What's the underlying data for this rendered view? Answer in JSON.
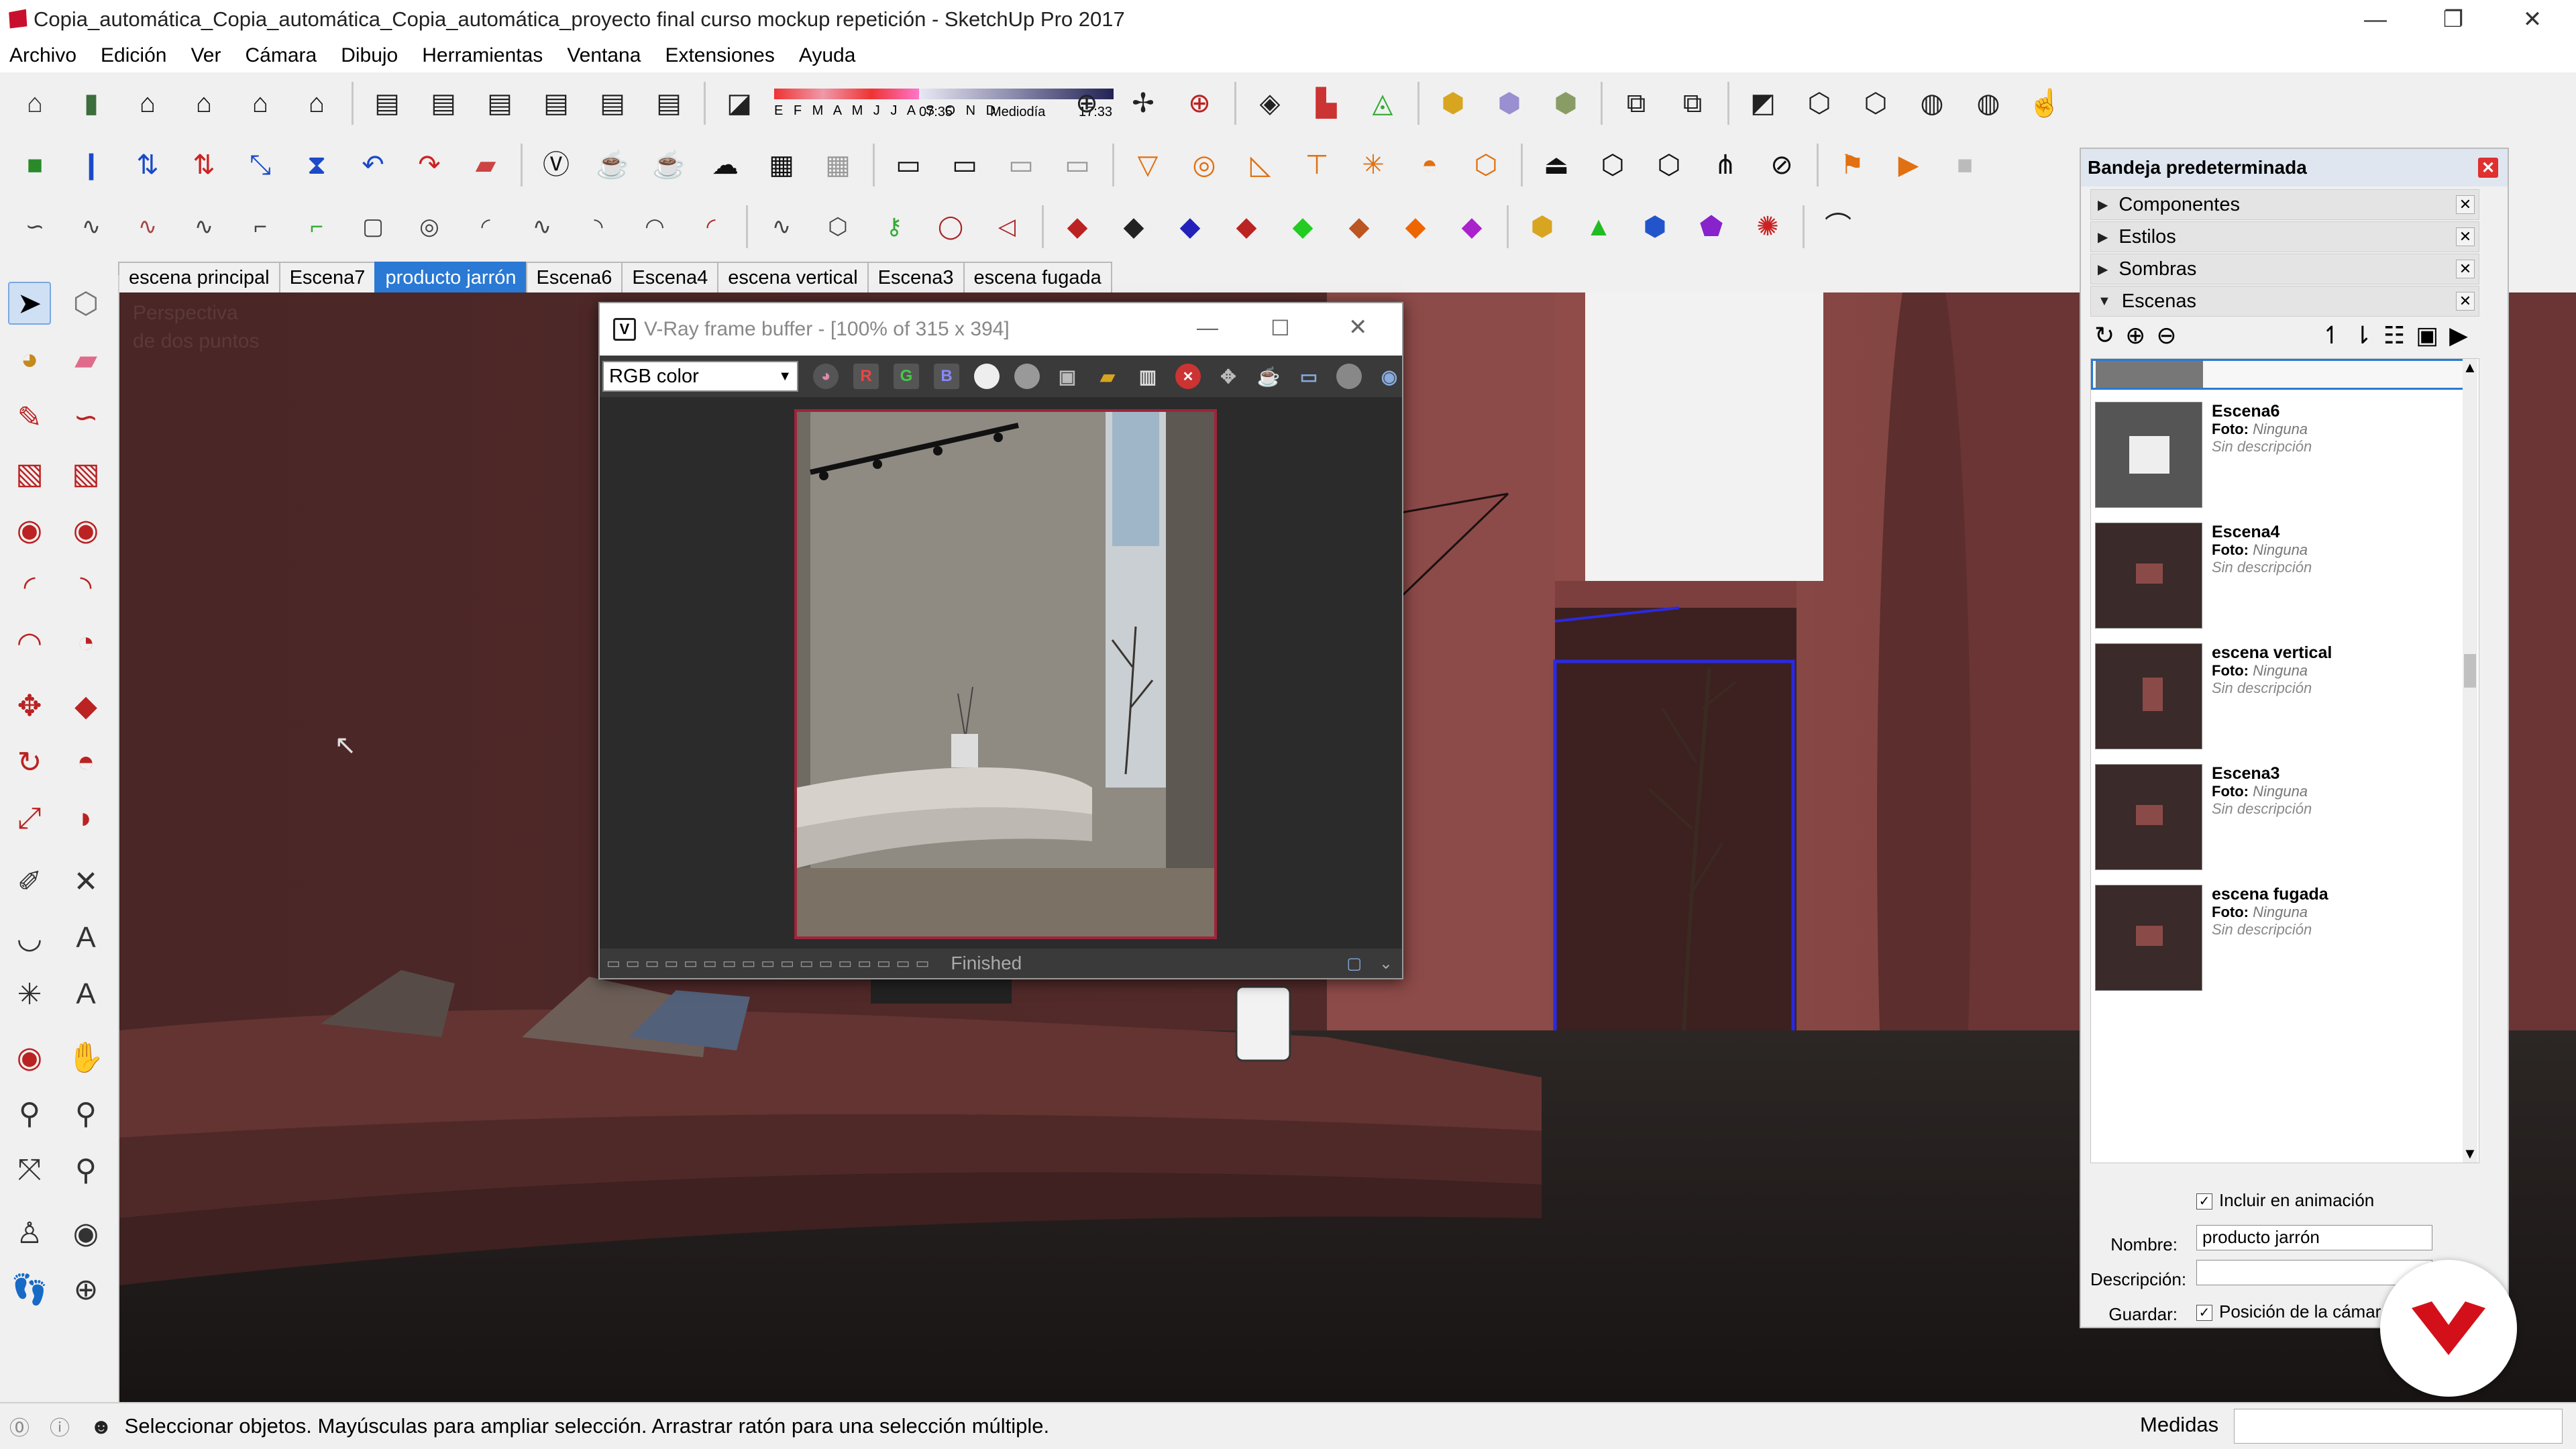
{
  "window": {
    "title": "Copia_automática_Copia_automática_Copia_automática_proyecto final curso mockup repetición - SketchUp Pro 2017",
    "minimize_label": "—",
    "restore_label": "❐",
    "close_label": "✕"
  },
  "menu": [
    "Archivo",
    "Edición",
    "Ver",
    "Cámara",
    "Dibujo",
    "Herramientas",
    "Ventana",
    "Extensiones",
    "Ayuda"
  ],
  "shadows": {
    "months": "E F M A M J J A S O N D",
    "time_start": "07:35",
    "time_mid": "Mediodía",
    "time_end": "17:33"
  },
  "scene_tabs": [
    {
      "label": "escena principal",
      "active": false
    },
    {
      "label": "Escena7",
      "active": false
    },
    {
      "label": "producto jarrón",
      "active": true
    },
    {
      "label": "Escena6",
      "active": false
    },
    {
      "label": "Escena4",
      "active": false
    },
    {
      "label": "escena vertical",
      "active": false
    },
    {
      "label": "Escena3",
      "active": false
    },
    {
      "label": "escena fugada",
      "active": false
    }
  ],
  "viewport": {
    "label_line1": "Perspectiva",
    "label_line2": "de dos puntos"
  },
  "vray": {
    "title": "V-Ray frame buffer - [100% of 315 x 394]",
    "channel": "RGB color",
    "btn_r": "R",
    "btn_g": "G",
    "btn_b": "B",
    "status": "Finished"
  },
  "tray": {
    "title": "Bandeja predeterminada",
    "sections": [
      "Componentes",
      "Estilos",
      "Sombras",
      "Escenas"
    ],
    "scenes": [
      {
        "name": "Escena6",
        "foto_label": "Foto:",
        "foto_value": "Ninguna",
        "desc": "Sin descripción"
      },
      {
        "name": "Escena4",
        "foto_label": "Foto:",
        "foto_value": "Ninguna",
        "desc": "Sin descripción"
      },
      {
        "name": "escena vertical",
        "foto_label": "Foto:",
        "foto_value": "Ninguna",
        "desc": "Sin descripción"
      },
      {
        "name": "Escena3",
        "foto_label": "Foto:",
        "foto_value": "Ninguna",
        "desc": "Sin descripción"
      },
      {
        "name": "escena fugada",
        "foto_label": "Foto:",
        "foto_value": "Ninguna",
        "desc": "Sin descripción"
      }
    ],
    "include_animation": "Incluir en animación",
    "name_label": "Nombre:",
    "name_value": "producto jarrón",
    "desc_label": "Descripción:",
    "desc_value": "",
    "save_label": "Guardar:",
    "save_option": "Posición de la cámar"
  },
  "status": {
    "text": "Seleccionar objetos. Mayúsculas para ampliar selección. Arrastrar ratón para una selección múltiple.",
    "medidas_label": "Medidas"
  },
  "colors": {
    "accent": "#2a79d4",
    "logo": "#d3101a",
    "wall": "#8c4a48"
  }
}
